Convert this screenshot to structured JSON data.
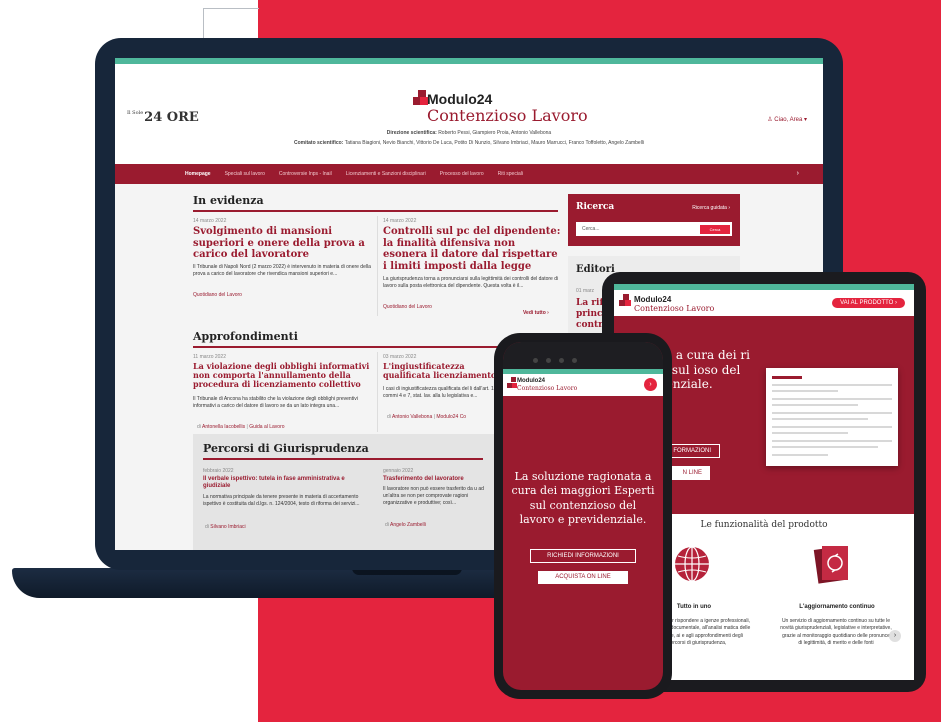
{
  "colors": {
    "brand_red": "#9a1b2f",
    "accent_red": "#e4243e",
    "teal": "#4fb79b",
    "laptop": "#17263a"
  },
  "laptop": {
    "ore_small": "Il Sole",
    "ore_label": "24 ORE",
    "brand_name": "Modulo24",
    "brand_sub": "Contenzioso Lavoro",
    "user_label": "Ciao, Area",
    "direzione_label": "Direzione scientifica:",
    "direzione_names": "Roberto Pessi, Giampiero Proia, Antonio Vallebona",
    "comitato_label": "Comitato scientifico:",
    "comitato_names": "Tatiana Biagioni, Nevio Bianchi, Vittorio De Luca, Potito Di Nunzio, Silvano Imbriaci, Mauro Marrucci, Franco Toffoletto, Angelo Zambelli",
    "nav": [
      "Homepage",
      "Speciali sul lavoro",
      "Controversie Inps - Inail",
      "Licenziamenti e Sanzioni disciplinari",
      "Processo del lavoro",
      "Riti speciali"
    ],
    "nav_arrow": "›",
    "evidenza": {
      "heading": "In evidenza",
      "a1_date": "14 marzo 2022",
      "a1_title": "Svolgimento di mansioni superiori e onere della prova a carico del lavoratore",
      "a1_body": "Il Tribunale di Napoli Nord (2 marzo 2022) è intervenuto in materia di onere della prova a carico del lavoratore che rivendica mansioni superiori e...",
      "a1_src": "Quotidiano del Lavoro",
      "a2_date": "14 marzo 2022",
      "a2_title": "Controlli sul pc del dipendente: la finalità difensiva non esonera il datore dal rispettare i limiti imposti dalla legge",
      "a2_body": "La giurisprudenza torna a pronunciarsi sulla legittimità dei controlli del datore di lavoro sulla posta elettronica del dipendente. Questa volta è il...",
      "a2_src": "Quotidiano del Lavoro",
      "more": "Vedi tutto ›"
    },
    "ricerca": {
      "title": "Ricerca",
      "advanced": "Ricerca guidata ›",
      "placeholder": "Cerca...",
      "button": "Cerca"
    },
    "editoriali": {
      "heading": "Editori",
      "date": "01 marz",
      "title": "La rifo princip contro"
    },
    "approf": {
      "heading": "Approfondimenti",
      "a1_date": "11 marzo 2022",
      "a1_title": "La violazione degli obblighi informativi non comporta l'annullamento della procedura di licenziamento collettivo",
      "a1_body": "Il Tribunale di Ancona ha stabilito che la violazione degli obblighi preventivi informativi a carico del datore di lavoro se da un lato integra una...",
      "a1_by": "di",
      "a1_author": "Antonella Iacobellis",
      "a1_sep": "|",
      "a1_src": "Guida al Lavoro",
      "a2_date": "03 marzo 2022",
      "a2_title": "L'ingiustificatezza qualificata licenziamento",
      "a2_body": "I casi di ingiustificatezza qualificata del li dall'art. 18, commi 4 e 7, stat. lav. alla lu legislativa e...",
      "a2_by": "di",
      "a2_author": "Antonio Vallebona",
      "a2_sep": "|",
      "a2_src": "Modulo24 Co"
    },
    "percorsi": {
      "heading": "Percorsi di Giurisprudenza",
      "a1_date": "febbraio 2022",
      "a1_title": "Il verbale ispettivo: tutela in fase amministrativa e giudiziale",
      "a1_body": "La normativa principale da tenere presente in materia di accertamento ispettivo è costituita dal d.lgs. n. 124/2004, testo di riforma dei servizi...",
      "a1_by": "di",
      "a1_author": "Silvano Imbriaci",
      "a2_date": "gennaio 2022",
      "a2_title": "Trasferimento del lavoratore",
      "a2_body": "Il lavoratore non può essere trasferito da u ad un'altra se non per comprovate ragioni organizzative e produttive; così...",
      "a2_by": "di",
      "a2_author": "Angelo Zambelli"
    }
  },
  "tablet": {
    "brand_name": "Modulo24",
    "brand_sub": "Contenzioso Lavoro",
    "vai_button": "VAI AL PRODOTTO ›",
    "hero_text": "zione ta a cura dei ri Esperti sul ioso del lavoro enziale.",
    "btn_info": "FORMAZIONI",
    "btn_buy": "N LINE",
    "func_title": "Le funzionalità del prodotto",
    "f1_title": "Tutto in uno",
    "f1_body": "soluzione per rispondere a igenze professionali, grazie ezza documentale, all'analisi matica delle procedure, ai e agli approfondimenti degli percorsi di giurisprudenza,",
    "f2_title": "L'aggiornamento continuo",
    "f2_body": "Un servizio di aggiornamento continuo su tutte le novità giurisprudenziali, legislative e interpretative, grazie al monitoraggio quotidiano delle pronunce di legittimità, di merito e delle fonti",
    "next": "›"
  },
  "phone": {
    "brand_name": "Modulo24",
    "brand_sub": "Contenzioso Lavoro",
    "go": "›",
    "headline": "La soluzione ragionata a cura dei maggiori Esperti sul contenzioso del lavoro e previdenziale.",
    "btn_info": "RICHIEDI INFORMAZIONI",
    "btn_buy": "ACQUISTA ON LINE"
  }
}
